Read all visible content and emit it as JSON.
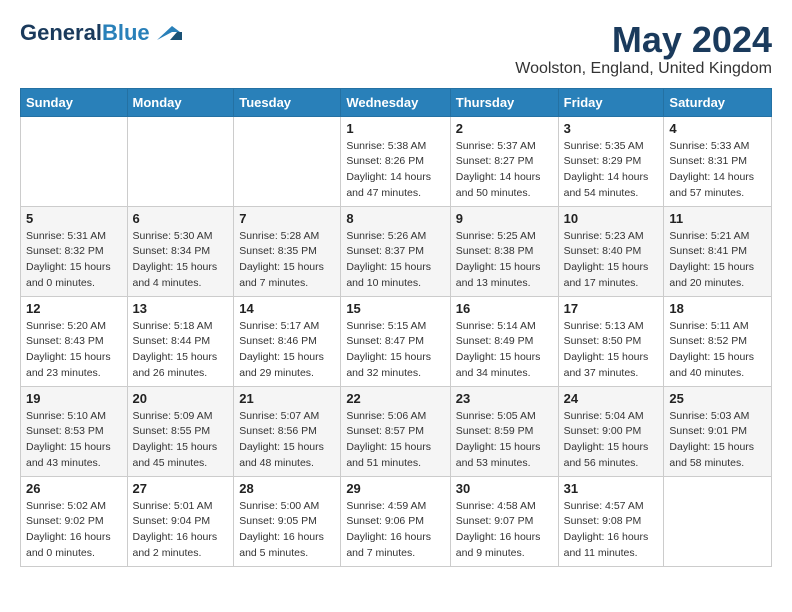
{
  "header": {
    "logo_general": "General",
    "logo_blue": "Blue",
    "month": "May 2024",
    "location": "Woolston, England, United Kingdom"
  },
  "days_of_week": [
    "Sunday",
    "Monday",
    "Tuesday",
    "Wednesday",
    "Thursday",
    "Friday",
    "Saturday"
  ],
  "weeks": [
    [
      {
        "day": "",
        "text": ""
      },
      {
        "day": "",
        "text": ""
      },
      {
        "day": "",
        "text": ""
      },
      {
        "day": "1",
        "text": "Sunrise: 5:38 AM\nSunset: 8:26 PM\nDaylight: 14 hours\nand 47 minutes."
      },
      {
        "day": "2",
        "text": "Sunrise: 5:37 AM\nSunset: 8:27 PM\nDaylight: 14 hours\nand 50 minutes."
      },
      {
        "day": "3",
        "text": "Sunrise: 5:35 AM\nSunset: 8:29 PM\nDaylight: 14 hours\nand 54 minutes."
      },
      {
        "day": "4",
        "text": "Sunrise: 5:33 AM\nSunset: 8:31 PM\nDaylight: 14 hours\nand 57 minutes."
      }
    ],
    [
      {
        "day": "5",
        "text": "Sunrise: 5:31 AM\nSunset: 8:32 PM\nDaylight: 15 hours\nand 0 minutes."
      },
      {
        "day": "6",
        "text": "Sunrise: 5:30 AM\nSunset: 8:34 PM\nDaylight: 15 hours\nand 4 minutes."
      },
      {
        "day": "7",
        "text": "Sunrise: 5:28 AM\nSunset: 8:35 PM\nDaylight: 15 hours\nand 7 minutes."
      },
      {
        "day": "8",
        "text": "Sunrise: 5:26 AM\nSunset: 8:37 PM\nDaylight: 15 hours\nand 10 minutes."
      },
      {
        "day": "9",
        "text": "Sunrise: 5:25 AM\nSunset: 8:38 PM\nDaylight: 15 hours\nand 13 minutes."
      },
      {
        "day": "10",
        "text": "Sunrise: 5:23 AM\nSunset: 8:40 PM\nDaylight: 15 hours\nand 17 minutes."
      },
      {
        "day": "11",
        "text": "Sunrise: 5:21 AM\nSunset: 8:41 PM\nDaylight: 15 hours\nand 20 minutes."
      }
    ],
    [
      {
        "day": "12",
        "text": "Sunrise: 5:20 AM\nSunset: 8:43 PM\nDaylight: 15 hours\nand 23 minutes."
      },
      {
        "day": "13",
        "text": "Sunrise: 5:18 AM\nSunset: 8:44 PM\nDaylight: 15 hours\nand 26 minutes."
      },
      {
        "day": "14",
        "text": "Sunrise: 5:17 AM\nSunset: 8:46 PM\nDaylight: 15 hours\nand 29 minutes."
      },
      {
        "day": "15",
        "text": "Sunrise: 5:15 AM\nSunset: 8:47 PM\nDaylight: 15 hours\nand 32 minutes."
      },
      {
        "day": "16",
        "text": "Sunrise: 5:14 AM\nSunset: 8:49 PM\nDaylight: 15 hours\nand 34 minutes."
      },
      {
        "day": "17",
        "text": "Sunrise: 5:13 AM\nSunset: 8:50 PM\nDaylight: 15 hours\nand 37 minutes."
      },
      {
        "day": "18",
        "text": "Sunrise: 5:11 AM\nSunset: 8:52 PM\nDaylight: 15 hours\nand 40 minutes."
      }
    ],
    [
      {
        "day": "19",
        "text": "Sunrise: 5:10 AM\nSunset: 8:53 PM\nDaylight: 15 hours\nand 43 minutes."
      },
      {
        "day": "20",
        "text": "Sunrise: 5:09 AM\nSunset: 8:55 PM\nDaylight: 15 hours\nand 45 minutes."
      },
      {
        "day": "21",
        "text": "Sunrise: 5:07 AM\nSunset: 8:56 PM\nDaylight: 15 hours\nand 48 minutes."
      },
      {
        "day": "22",
        "text": "Sunrise: 5:06 AM\nSunset: 8:57 PM\nDaylight: 15 hours\nand 51 minutes."
      },
      {
        "day": "23",
        "text": "Sunrise: 5:05 AM\nSunset: 8:59 PM\nDaylight: 15 hours\nand 53 minutes."
      },
      {
        "day": "24",
        "text": "Sunrise: 5:04 AM\nSunset: 9:00 PM\nDaylight: 15 hours\nand 56 minutes."
      },
      {
        "day": "25",
        "text": "Sunrise: 5:03 AM\nSunset: 9:01 PM\nDaylight: 15 hours\nand 58 minutes."
      }
    ],
    [
      {
        "day": "26",
        "text": "Sunrise: 5:02 AM\nSunset: 9:02 PM\nDaylight: 16 hours\nand 0 minutes."
      },
      {
        "day": "27",
        "text": "Sunrise: 5:01 AM\nSunset: 9:04 PM\nDaylight: 16 hours\nand 2 minutes."
      },
      {
        "day": "28",
        "text": "Sunrise: 5:00 AM\nSunset: 9:05 PM\nDaylight: 16 hours\nand 5 minutes."
      },
      {
        "day": "29",
        "text": "Sunrise: 4:59 AM\nSunset: 9:06 PM\nDaylight: 16 hours\nand 7 minutes."
      },
      {
        "day": "30",
        "text": "Sunrise: 4:58 AM\nSunset: 9:07 PM\nDaylight: 16 hours\nand 9 minutes."
      },
      {
        "day": "31",
        "text": "Sunrise: 4:57 AM\nSunset: 9:08 PM\nDaylight: 16 hours\nand 11 minutes."
      },
      {
        "day": "",
        "text": ""
      }
    ]
  ]
}
